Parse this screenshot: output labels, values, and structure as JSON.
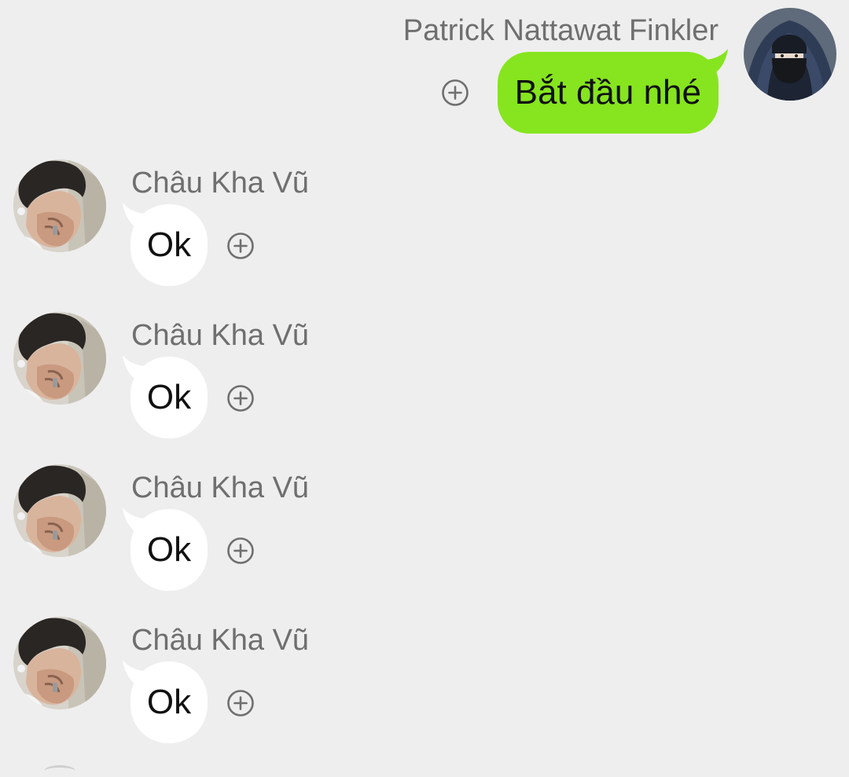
{
  "messages": [
    {
      "sender": "Patrick Nattawat Finkler",
      "text": "Bắt đầu nhé",
      "side": "right",
      "bubble_color": "#86e51e",
      "action_icon": "plus-circle-icon"
    },
    {
      "sender": "Châu Kha Vũ",
      "text": "Ok",
      "side": "left",
      "bubble_color": "#ffffff",
      "action_icon": "plus-circle-icon"
    },
    {
      "sender": "Châu Kha Vũ",
      "text": "Ok",
      "side": "left",
      "bubble_color": "#ffffff",
      "action_icon": "plus-circle-icon"
    },
    {
      "sender": "Châu Kha Vũ",
      "text": "Ok",
      "side": "left",
      "bubble_color": "#ffffff",
      "action_icon": "plus-circle-icon"
    },
    {
      "sender": "Châu Kha Vũ",
      "text": "Ok",
      "side": "left",
      "bubble_color": "#ffffff",
      "action_icon": "plus-circle-icon"
    }
  ],
  "colors": {
    "background": "#eeeeee",
    "name_text": "#6f6f6f",
    "outgoing_bubble": "#86e51e",
    "incoming_bubble": "#ffffff"
  }
}
